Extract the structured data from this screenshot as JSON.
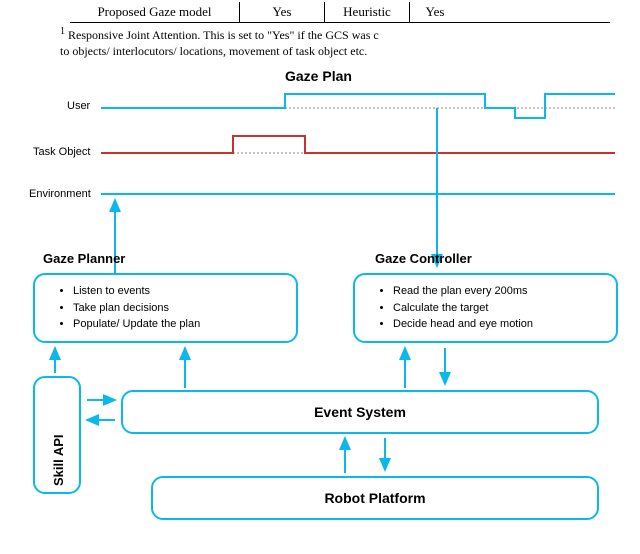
{
  "table": {
    "row": {
      "name": "Proposed Gaze model",
      "col2": "Yes",
      "col3": "Heuristic",
      "col4": "Yes"
    },
    "footnote_sup": "1",
    "footnote_line1": " Responsive Joint Attention. This is set to \"Yes\" if the GCS was c",
    "footnote_line2": "to objects/ interlocutors/ locations, movement of task object etc."
  },
  "diagram": {
    "title": "Gaze Plan",
    "labels": {
      "user": "User",
      "task_object": "Task Object",
      "environment": "Environment"
    },
    "gaze_planner_label": "Gaze Planner",
    "gaze_controller_label": "Gaze Controller",
    "planner_items": [
      "Listen to events",
      "Take plan decisions",
      "Populate/ Update the plan"
    ],
    "controller_items": [
      "Read the plan every 200ms",
      "Calculate the target",
      "Decide head and eye motion"
    ],
    "skill_api": "Skill API",
    "event_system": "Event System",
    "robot_platform": "Robot Platform"
  }
}
